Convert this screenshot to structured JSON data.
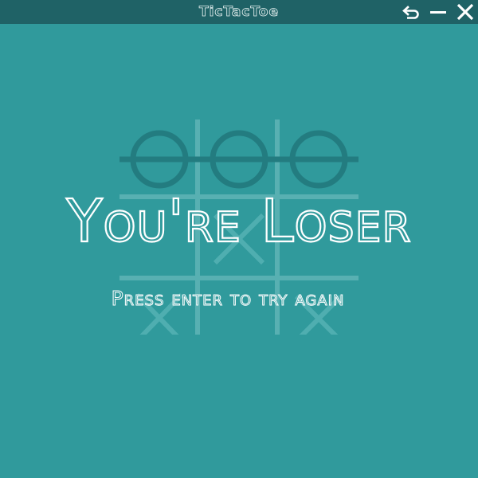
{
  "window": {
    "title": "TicTacToe",
    "buttons": {
      "restart_icon": "undo-arrow-icon",
      "minimize_icon": "minus-icon",
      "close_icon": "close-icon"
    }
  },
  "colors": {
    "background": "#309a9c",
    "titlebar": "#1f6266",
    "grid_line": "#58b0b2",
    "o_mark": "#237c80",
    "x_mark": "#4faeb0",
    "text_outline": "#ffffff"
  },
  "board": {
    "cells": [
      "O",
      "O",
      "O",
      "",
      "X",
      "",
      "X",
      "",
      "X"
    ],
    "winning_line": "top-row"
  },
  "message": {
    "headline": "You're Loser",
    "subline": "Press enter to try again"
  }
}
